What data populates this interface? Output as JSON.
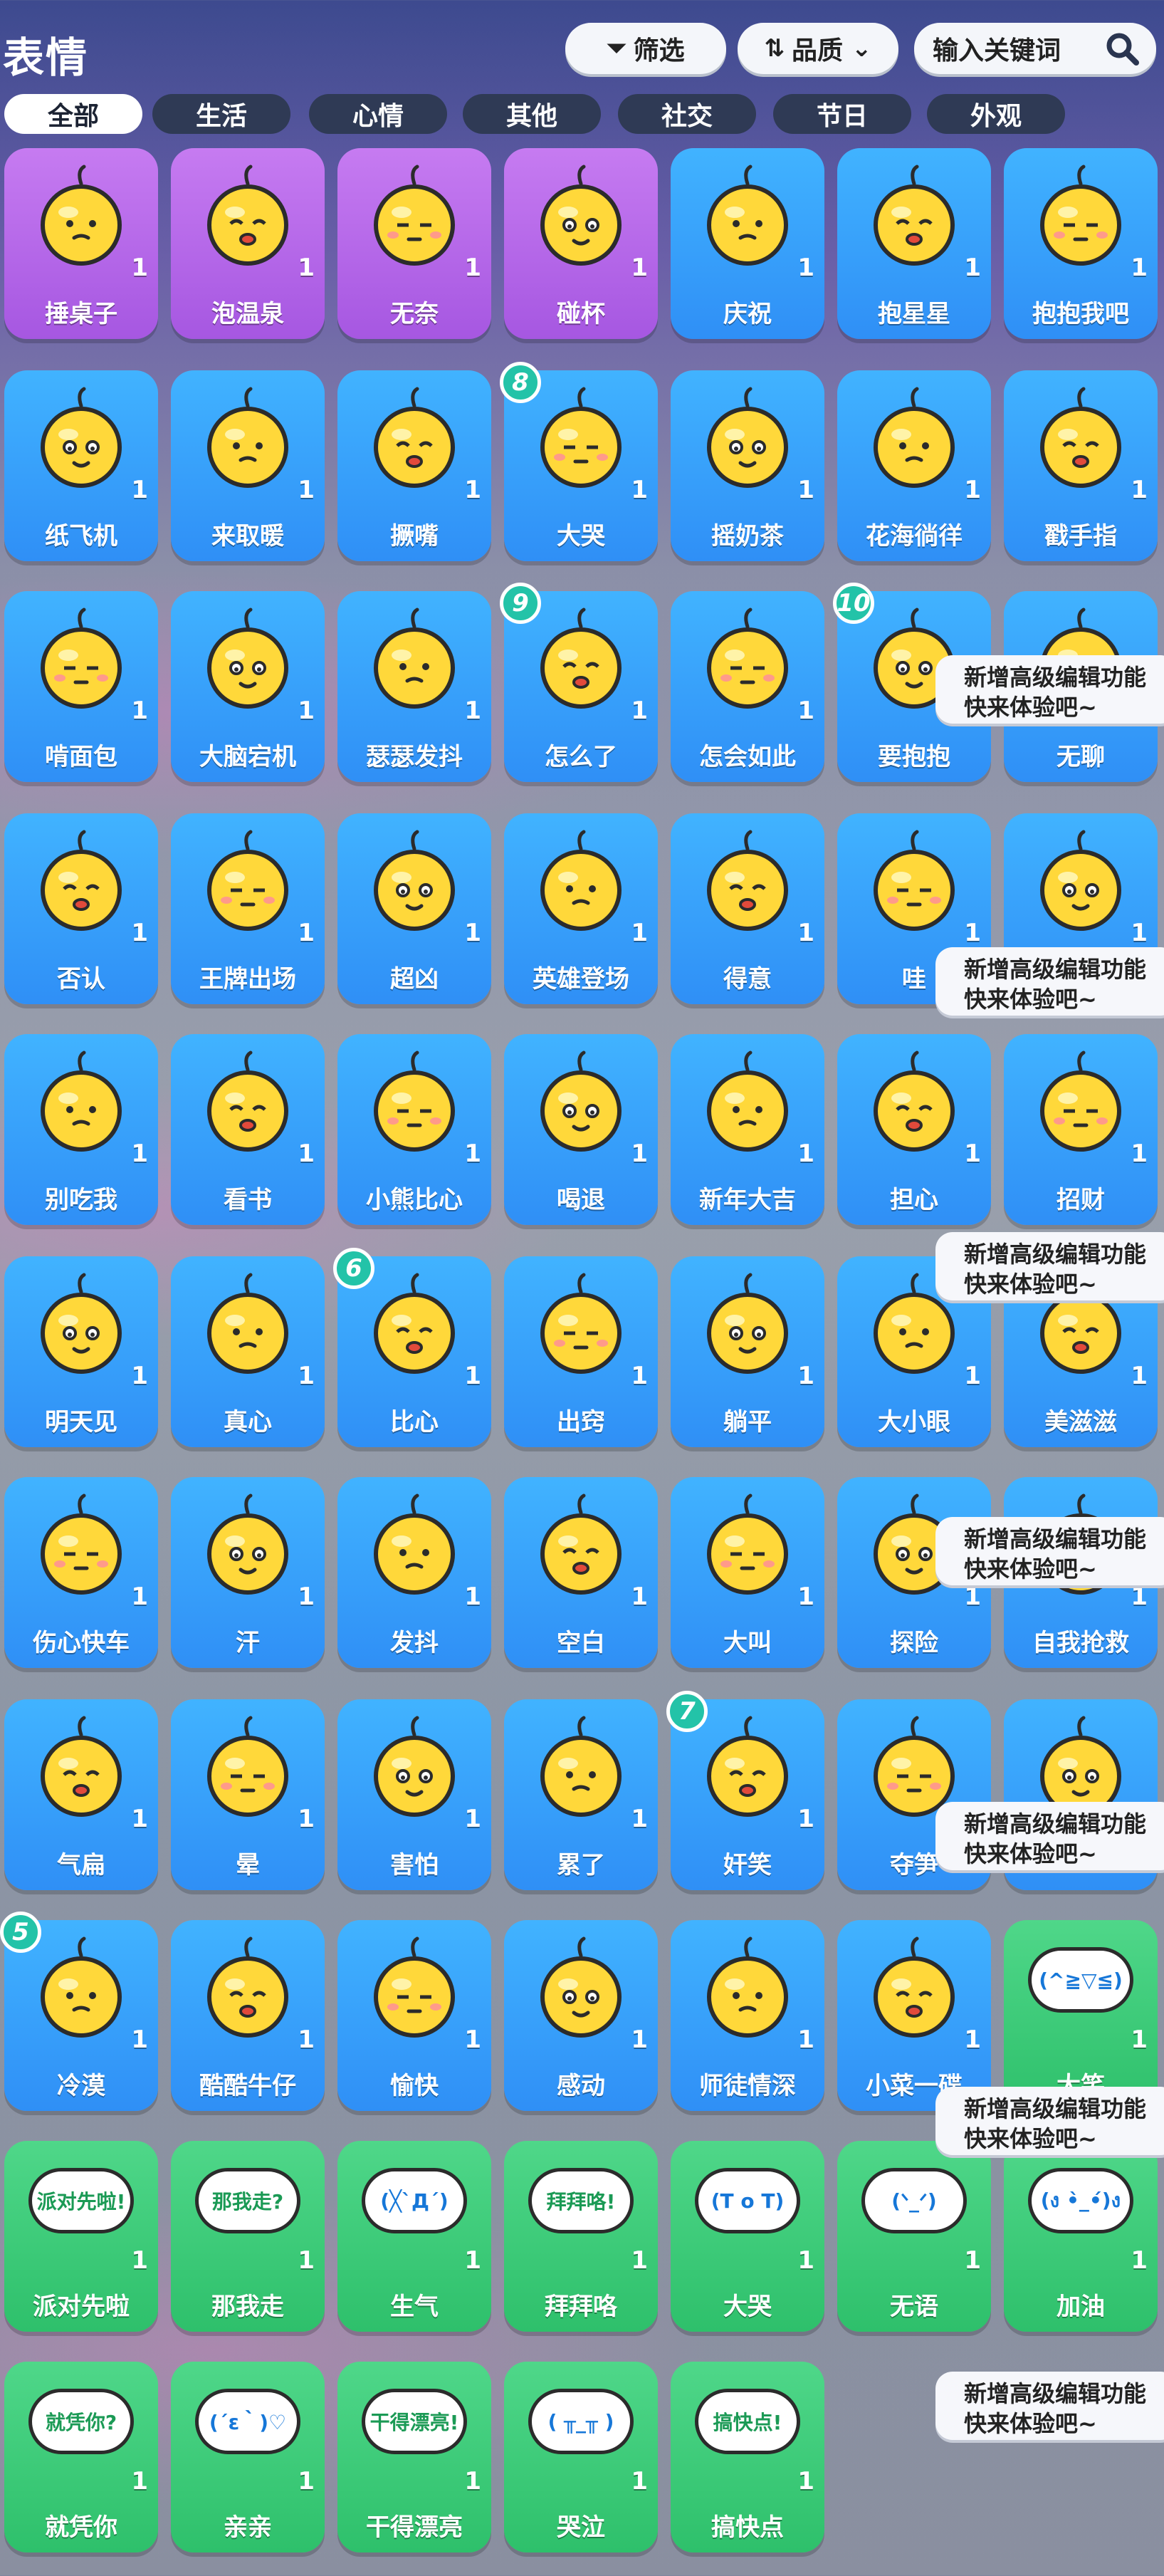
{
  "header": {
    "title": "表情",
    "filter_label": "筛选",
    "sort_label": "品质",
    "search_placeholder": "输入关键词"
  },
  "tabs": [
    "全部",
    "生活",
    "心情",
    "其他",
    "社交",
    "节日",
    "外观"
  ],
  "colors": {
    "blue": "#2f8ff6",
    "purple": "#a657e1",
    "green": "#2ec06b",
    "rank": "#23c3a8"
  },
  "emotes": [
    {
      "label": "捶桌子",
      "count": "1",
      "tier": "purple"
    },
    {
      "label": "泡温泉",
      "count": "1",
      "tier": "purple"
    },
    {
      "label": "无奈",
      "count": "1",
      "tier": "purple"
    },
    {
      "label": "碰杯",
      "count": "1",
      "tier": "purple"
    },
    {
      "label": "庆祝",
      "count": "1",
      "tier": "blue"
    },
    {
      "label": "抱星星",
      "count": "1",
      "tier": "blue"
    },
    {
      "label": "抱抱我吧",
      "count": "1",
      "tier": "blue"
    },
    {
      "label": "纸飞机",
      "count": "1",
      "tier": "blue"
    },
    {
      "label": "来取暖",
      "count": "1",
      "tier": "blue"
    },
    {
      "label": "撅嘴",
      "count": "1",
      "tier": "blue"
    },
    {
      "label": "大哭",
      "count": "1",
      "tier": "blue",
      "rank": "8"
    },
    {
      "label": "摇奶茶",
      "count": "1",
      "tier": "blue"
    },
    {
      "label": "花海徜徉",
      "count": "1",
      "tier": "blue"
    },
    {
      "label": "戳手指",
      "count": "1",
      "tier": "blue"
    },
    {
      "label": "啃面包",
      "count": "1",
      "tier": "blue"
    },
    {
      "label": "大脑宕机",
      "count": "1",
      "tier": "blue"
    },
    {
      "label": "瑟瑟发抖",
      "count": "1",
      "tier": "blue"
    },
    {
      "label": "怎么了",
      "count": "1",
      "tier": "blue",
      "rank": "9"
    },
    {
      "label": "怎会如此",
      "count": "1",
      "tier": "blue"
    },
    {
      "label": "要抱抱",
      "count": "1",
      "tier": "blue",
      "rank": "10"
    },
    {
      "label": "无聊",
      "count": "1",
      "tier": "blue"
    },
    {
      "label": "否认",
      "count": "1",
      "tier": "blue"
    },
    {
      "label": "王牌出场",
      "count": "1",
      "tier": "blue"
    },
    {
      "label": "超凶",
      "count": "1",
      "tier": "blue"
    },
    {
      "label": "英雄登场",
      "count": "1",
      "tier": "blue"
    },
    {
      "label": "得意",
      "count": "1",
      "tier": "blue"
    },
    {
      "label": "哇",
      "count": "1",
      "tier": "blue"
    },
    {
      "label": "",
      "count": "1",
      "tier": "blue"
    },
    {
      "label": "别吃我",
      "count": "1",
      "tier": "blue"
    },
    {
      "label": "看书",
      "count": "1",
      "tier": "blue"
    },
    {
      "label": "小熊比心",
      "count": "1",
      "tier": "blue"
    },
    {
      "label": "喝退",
      "count": "1",
      "tier": "blue"
    },
    {
      "label": "新年大吉",
      "count": "1",
      "tier": "blue"
    },
    {
      "label": "担心",
      "count": "1",
      "tier": "blue"
    },
    {
      "label": "招财",
      "count": "1",
      "tier": "blue"
    },
    {
      "label": "明天见",
      "count": "1",
      "tier": "blue"
    },
    {
      "label": "真心",
      "count": "1",
      "tier": "blue"
    },
    {
      "label": "比心",
      "count": "1",
      "tier": "blue",
      "rank": "6"
    },
    {
      "label": "出窍",
      "count": "1",
      "tier": "blue"
    },
    {
      "label": "躺平",
      "count": "1",
      "tier": "blue"
    },
    {
      "label": "大小眼",
      "count": "1",
      "tier": "blue"
    },
    {
      "label": "美滋滋",
      "count": "1",
      "tier": "blue"
    },
    {
      "label": "伤心快车",
      "count": "1",
      "tier": "blue"
    },
    {
      "label": "汗",
      "count": "1",
      "tier": "blue"
    },
    {
      "label": "发抖",
      "count": "1",
      "tier": "blue"
    },
    {
      "label": "空白",
      "count": "1",
      "tier": "blue"
    },
    {
      "label": "大叫",
      "count": "1",
      "tier": "blue"
    },
    {
      "label": "探险",
      "count": "1",
      "tier": "blue"
    },
    {
      "label": "自我抢救",
      "count": "1",
      "tier": "blue"
    },
    {
      "label": "气扁",
      "count": "1",
      "tier": "blue"
    },
    {
      "label": "晕",
      "count": "1",
      "tier": "blue"
    },
    {
      "label": "害怕",
      "count": "1",
      "tier": "blue"
    },
    {
      "label": "累了",
      "count": "1",
      "tier": "blue"
    },
    {
      "label": "奸笑",
      "count": "1",
      "tier": "blue",
      "rank": "7"
    },
    {
      "label": "夺笋",
      "count": "1",
      "tier": "blue"
    },
    {
      "label": "",
      "count": "1",
      "tier": "blue"
    },
    {
      "label": "冷漠",
      "count": "1",
      "tier": "blue",
      "rank": "5"
    },
    {
      "label": "酷酷牛仔",
      "count": "1",
      "tier": "blue"
    },
    {
      "label": "愉快",
      "count": "1",
      "tier": "blue"
    },
    {
      "label": "感动",
      "count": "1",
      "tier": "blue"
    },
    {
      "label": "师徒情深",
      "count": "1",
      "tier": "blue"
    },
    {
      "label": "小菜一碟",
      "count": "1",
      "tier": "blue"
    },
    {
      "label": "大笑",
      "count": "1",
      "tier": "green",
      "kaomoji": "(^≧▽≦)"
    },
    {
      "label": "派对先啦",
      "count": "1",
      "tier": "green",
      "kaomoji": "派对先啦!"
    },
    {
      "label": "那我走",
      "count": "1",
      "tier": "green",
      "kaomoji": "那我走?"
    },
    {
      "label": "生气",
      "count": "1",
      "tier": "green",
      "kaomoji": "(╳`Д´)"
    },
    {
      "label": "拜拜咯",
      "count": "1",
      "tier": "green",
      "kaomoji": "拜拜咯!"
    },
    {
      "label": "大哭",
      "count": "1",
      "tier": "green",
      "kaomoji": "(T o T)"
    },
    {
      "label": "无语",
      "count": "1",
      "tier": "green",
      "kaomoji": "(ᐠ_ᐟ)"
    },
    {
      "label": "加油",
      "count": "1",
      "tier": "green",
      "kaomoji": "(ง •̀_•́)ง"
    },
    {
      "label": "就凭你",
      "count": "1",
      "tier": "green",
      "kaomoji": "就凭你?"
    },
    {
      "label": "亲亲",
      "count": "1",
      "tier": "green",
      "kaomoji": "(´ε｀)♡"
    },
    {
      "label": "干得漂亮",
      "count": "1",
      "tier": "green",
      "kaomoji": "干得漂亮!"
    },
    {
      "label": "哭泣",
      "count": "1",
      "tier": "green",
      "kaomoji": "( ╥_╥ )"
    },
    {
      "label": "搞快点",
      "count": "1",
      "tier": "green",
      "kaomoji": "搞快点!"
    }
  ],
  "tooltips": [
    {
      "line1": "新增高级编辑功能",
      "line2": "快来体验吧~"
    },
    {
      "line1": "新增高级编辑功能",
      "line2": "快来体验吧~"
    },
    {
      "line1": "新增高级编辑功能",
      "line2": "快来体验吧~"
    },
    {
      "line1": "新增高级编辑功能",
      "line2": "快来体验吧~"
    },
    {
      "line1": "新增高级编辑功能",
      "line2": "快来体验吧~"
    },
    {
      "line1": "新增高级编辑功能",
      "line2": "快来体验吧~"
    },
    {
      "line1": "新增高级编辑功能",
      "line2": "快来体验吧~"
    }
  ]
}
